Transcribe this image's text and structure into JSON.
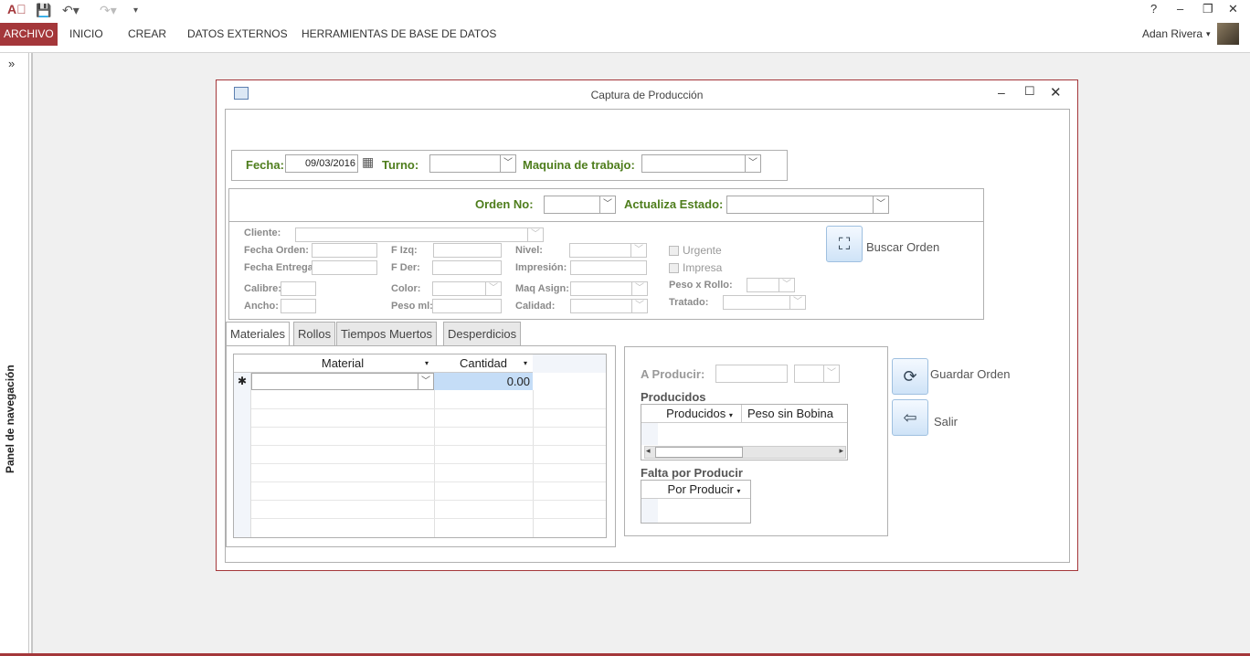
{
  "qat": {
    "app_icon": "access-icon",
    "save_icon": "save-icon",
    "undo_icon": "undo-icon",
    "redo_icon": "redo-icon",
    "customize_icon": "customize-qat-icon",
    "help": "?",
    "minimize": "–",
    "restore": "❐",
    "close": "✕"
  },
  "ribbon": {
    "tabs": [
      "ARCHIVO",
      "INICIO",
      "CREAR",
      "DATOS EXTERNOS",
      "HERRAMIENTAS DE BASE DE DATOS"
    ],
    "user": "Adan Rivera"
  },
  "navpane": {
    "label": "Panel de navegación",
    "expand": "»"
  },
  "form": {
    "title": "Captura de Producción",
    "fecha_label": "Fecha:",
    "fecha_value": "09/03/2016",
    "turno_label": "Turno:",
    "maquina_label": "Maquina de trabajo:",
    "orden_label": "Orden No:",
    "actualiza_label": "Actualiza Estado:",
    "cliente_label": "Cliente:",
    "fecha_orden_label": "Fecha Orden:",
    "fecha_entrega_label": "Fecha Entrega:",
    "calibre_label": "Calibre:",
    "ancho_label": "Ancho:",
    "fizq_label": "F Izq:",
    "fder_label": "F Der:",
    "color_label": "Color:",
    "pesoml_label": "Peso ml:",
    "nivel_label": "Nivel:",
    "impresion_label": "Impresión:",
    "maqasign_label": "Maq Asign:",
    "calidad_label": "Calidad:",
    "urgente_label": "Urgente",
    "impresa_label": "Impresa",
    "pesorollo_label": "Peso x Rollo:",
    "tratado_label": "Tratado:",
    "buscar_label": "Buscar Orden",
    "tabs": [
      "Materiales",
      "Rollos",
      "Tiempos Muertos",
      "Desperdicios"
    ],
    "grid": {
      "col_material": "Material",
      "col_cantidad": "Cantidad",
      "new_row_marker": "✱",
      "cantidad_value": "0.00"
    },
    "a_producir_label": "A Producir:",
    "producidos_label": "Producidos",
    "producidos_cols": [
      "Producidos",
      "Peso sin Bobina"
    ],
    "falta_label": "Falta por Producir",
    "por_producir_col": "Por Producir",
    "guardar_label": "Guardar Orden",
    "salir_label": "Salir"
  }
}
